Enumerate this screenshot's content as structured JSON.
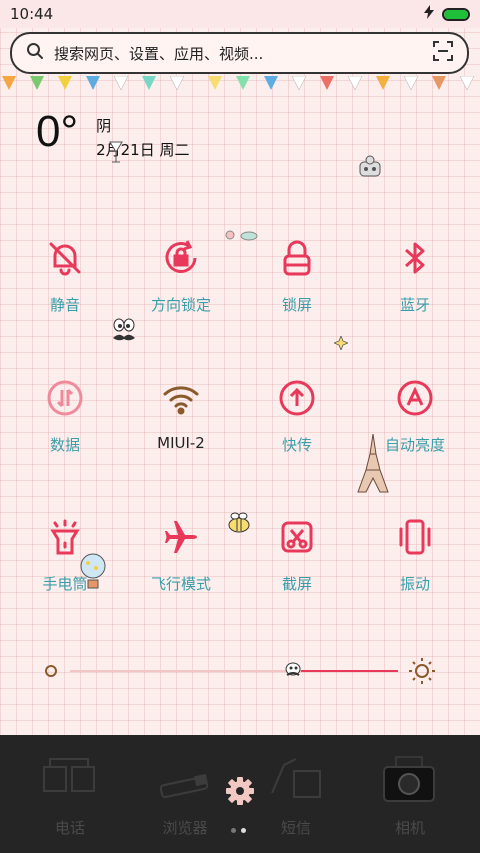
{
  "status_bar": {
    "time": "10:44",
    "battery_level": 1.0
  },
  "search": {
    "placeholder": "搜索网页、设置、应用、视频..."
  },
  "weather": {
    "temperature": "0°",
    "condition": "阴",
    "date": "2月21日 周二"
  },
  "toggles": [
    {
      "label": "静音",
      "icon": "bell-off-icon"
    },
    {
      "label": "方向锁定",
      "icon": "rotation-lock-icon"
    },
    {
      "label": "锁屏",
      "icon": "lock-icon"
    },
    {
      "label": "蓝牙",
      "icon": "bluetooth-icon"
    },
    {
      "label": "数据",
      "icon": "data-icon"
    },
    {
      "label": "MIUI-2",
      "icon": "wifi-icon"
    },
    {
      "label": "快传",
      "icon": "quick-transfer-icon"
    },
    {
      "label": "自动亮度",
      "icon": "auto-brightness-icon"
    },
    {
      "label": "手电筒",
      "icon": "flashlight-icon"
    },
    {
      "label": "飞行模式",
      "icon": "airplane-icon"
    },
    {
      "label": "截屏",
      "icon": "screenshot-icon"
    },
    {
      "label": "振动",
      "icon": "vibrate-icon"
    }
  ],
  "brightness": {
    "level": 0.68
  },
  "dock": [
    {
      "label": "电话"
    },
    {
      "label": "浏览器"
    },
    {
      "label": "短信"
    },
    {
      "label": "相机"
    }
  ],
  "pages": {
    "count": 2,
    "current": 2
  },
  "colors": {
    "accent": "#e8395a",
    "label": "#3a9ea9",
    "dock": "#252525"
  }
}
